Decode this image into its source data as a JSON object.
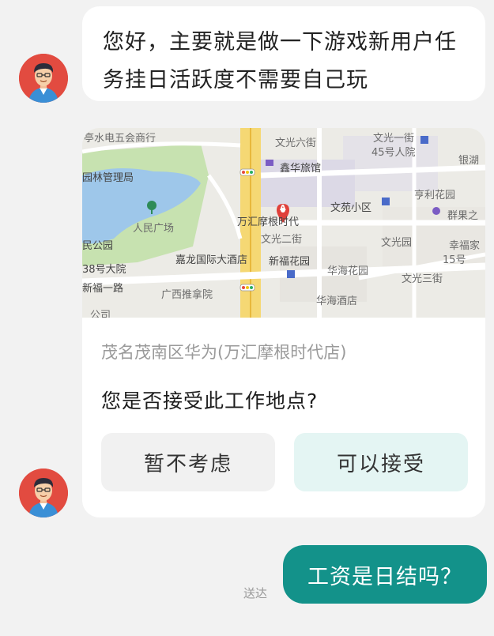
{
  "messages": {
    "incoming_text": "您好，主要就是做一下游戏新用户任务挂日活跃度不需要自己玩",
    "location_card": {
      "address": "茂名茂南区华为(万汇摩根时代店)",
      "question": "您是否接受此工作地点?",
      "decline_label": "暂不考虑",
      "accept_label": "可以接受",
      "map_labels": {
        "l1": "亭水电五会商行",
        "l2": "文光六街",
        "l3": "文光一街",
        "l4": "45号人院",
        "l5": "银湖",
        "l6": "园林管理局",
        "l7": "鑫华旅馆",
        "l8": "人民广场",
        "l9": "万汇摩根时代",
        "l10": "文苑小区",
        "l11": "亨利花园",
        "l12": "群果之",
        "l13": "文光二街",
        "l14": "文光园",
        "l15": "幸福家",
        "l16": "民公园",
        "l17": "嘉龙国际大酒店",
        "l18": "新福花园",
        "l19": "15号",
        "l20": "华海花园",
        "l21": "38号大院",
        "l22": "文光三街",
        "l23": "新福一路",
        "l24": "广西推拿院",
        "l25": "华海酒店",
        "l26": "公司",
        "pin": "A"
      }
    },
    "outgoing_text": "工资是日结吗？",
    "outgoing_status": "送达"
  },
  "colors": {
    "accent": "#13928a",
    "accept_bg": "#e4f5f3",
    "avatar_bg": "#e24b40"
  }
}
